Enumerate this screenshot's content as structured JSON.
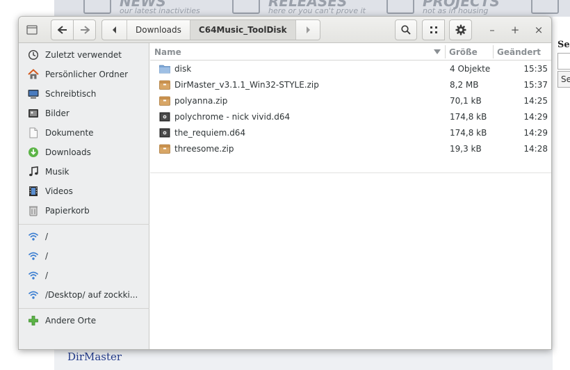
{
  "website": {
    "nav": [
      {
        "title": "NEWS",
        "subtitle": "our latest inactivities",
        "icon": "newspaper-icon"
      },
      {
        "title": "RELEASES",
        "subtitle": "here or you can't prove it",
        "icon": "release-icon"
      },
      {
        "title": "PROJECTS",
        "subtitle": "not as in housing",
        "icon": "tools-icon"
      }
    ],
    "search_label": "Sea",
    "search_select": "Se",
    "footer_link": "DirMaster"
  },
  "headerbar": {
    "path": [
      "Downloads",
      "C64Music_ToolDisk"
    ],
    "icons": {
      "sidebar_toggle": "sidebar-icon",
      "back": "back-arrow-icon",
      "forward": "forward-arrow-icon",
      "search": "search-icon",
      "view": "grid-view-icon",
      "menu": "gear-icon"
    },
    "window_controls": {
      "minimize": "–",
      "maximize": "+",
      "close": "×"
    }
  },
  "sidebar": {
    "places": [
      {
        "label": "Zuletzt verwendet",
        "icon": "recent-icon"
      },
      {
        "label": "Persönlicher Ordner",
        "icon": "home-icon"
      },
      {
        "label": "Schreibtisch",
        "icon": "desktop-icon"
      },
      {
        "label": "Bilder",
        "icon": "pictures-icon"
      },
      {
        "label": "Dokumente",
        "icon": "document-icon"
      },
      {
        "label": "Downloads",
        "icon": "download-icon"
      },
      {
        "label": "Musik",
        "icon": "music-icon"
      },
      {
        "label": "Videos",
        "icon": "video-icon"
      },
      {
        "label": "Papierkorb",
        "icon": "trash-icon"
      }
    ],
    "network": [
      {
        "label": "/",
        "icon": "network-icon"
      },
      {
        "label": "/",
        "icon": "network-icon"
      },
      {
        "label": "/",
        "icon": "network-icon"
      },
      {
        "label": "/Desktop/ auf zockki...",
        "icon": "network-icon"
      }
    ],
    "other": {
      "label": "Andere Orte",
      "icon": "plus-icon"
    }
  },
  "filelist": {
    "columns": {
      "name": "Name",
      "size": "Größe",
      "modified": "Geändert"
    },
    "rows": [
      {
        "name": "disk",
        "size": "4 Objekte",
        "modified": "15:35",
        "icon": "folder-icon"
      },
      {
        "name": "DirMaster_v3.1.1_Win32-STYLE.zip",
        "size": "8,2 MB",
        "modified": "15:37",
        "icon": "archive-icon"
      },
      {
        "name": "polyanna.zip",
        "size": "70,1 kB",
        "modified": "14:25",
        "icon": "archive-icon"
      },
      {
        "name": "polychrome - nick vivid.d64",
        "size": "174,8 kB",
        "modified": "14:29",
        "icon": "disk-image-icon"
      },
      {
        "name": "the_requiem.d64",
        "size": "174,8 kB",
        "modified": "14:29",
        "icon": "disk-image-icon"
      },
      {
        "name": "threesome.zip",
        "size": "19,3 kB",
        "modified": "14:28",
        "icon": "archive-icon"
      }
    ]
  }
}
